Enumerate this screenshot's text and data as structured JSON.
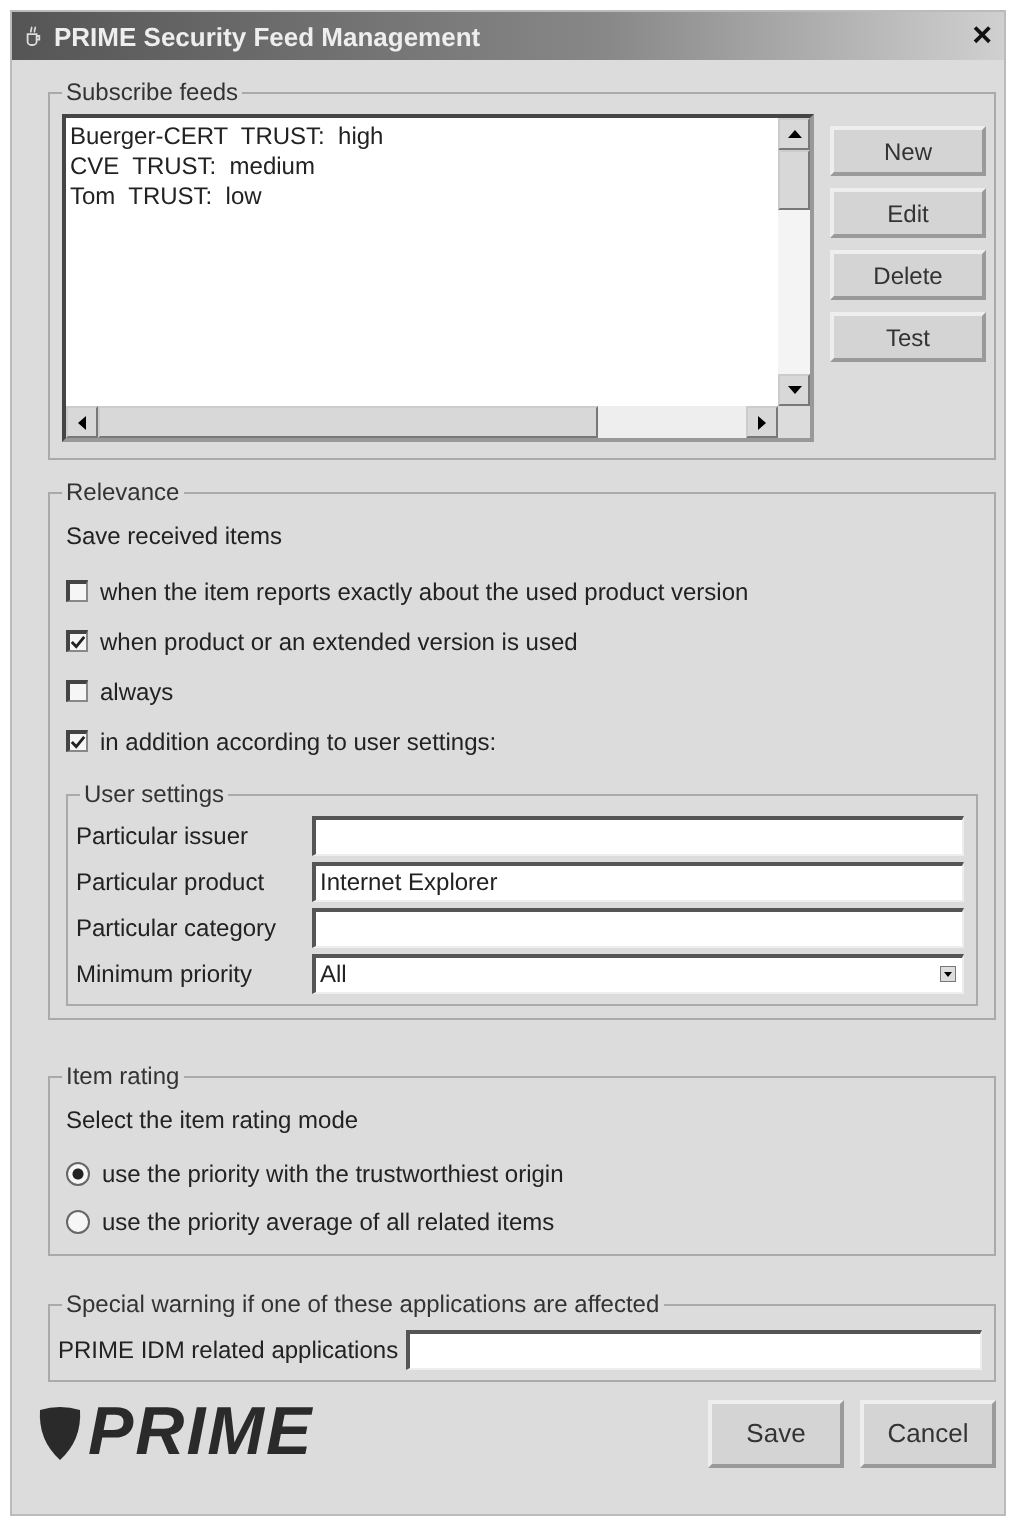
{
  "window": {
    "title": "PRIME Security Feed Management",
    "close": "×"
  },
  "feeds": {
    "title": "Subscribe feeds",
    "items": [
      {
        "label": "Buerger-CERT  TRUST:  high",
        "selected": false
      },
      {
        "label": "CVE  TRUST:  medium",
        "selected": false
      },
      {
        "label": "Tom  TRUST:  low",
        "selected": false
      }
    ],
    "buttons": [
      "New",
      "Edit",
      "Delete",
      "Test"
    ]
  },
  "relevance": {
    "title": "Relevance",
    "subtitle": "Save received items",
    "options": [
      {
        "label": "when the item reports exactly about the used product version",
        "checked": false
      },
      {
        "label": "when product or an extended version is used",
        "checked": true
      },
      {
        "label": "always",
        "checked": false
      },
      {
        "label": "in addition according to user settings:",
        "checked": true
      }
    ],
    "user_settings": {
      "title": "User settings",
      "fields": [
        {
          "kind": "text",
          "label": "Particular issuer"
        },
        {
          "kind": "text",
          "label": "Particular product",
          "value": "Internet Explorer"
        },
        {
          "kind": "text",
          "label": "Particular category"
        },
        {
          "kind": "dropdown",
          "label": "Minimum priority",
          "value": "All"
        }
      ]
    }
  },
  "item_rating": {
    "title": "Item rating",
    "subtitle": "Select the item rating mode",
    "options": [
      {
        "label": "use the priority with the trustworthiest origin",
        "selected": true
      },
      {
        "label": "use the priority average of all related items",
        "selected": false
      }
    ]
  },
  "warning": {
    "title": "Special warning if one of these applications are affected",
    "field_label": "PRIME IDM related applications"
  },
  "footer": {
    "logo": "PRIME",
    "buttons": [
      "Save",
      "Cancel"
    ]
  }
}
